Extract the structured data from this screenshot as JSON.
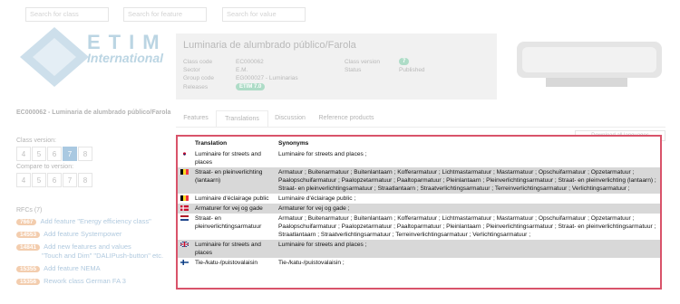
{
  "search": {
    "class_placeholder": "Search for class",
    "feature_placeholder": "Search for feature",
    "value_placeholder": "Search for value"
  },
  "logo": {
    "title": "ETIM",
    "subtitle": "International"
  },
  "infobox": {
    "title": "Luminaria de alumbrado público/Farola",
    "class_code_label": "Class code",
    "class_code": "EC000062",
    "sector_label": "Sector",
    "sector": "E.M.",
    "group_code_label": "Group code",
    "group_code": "EG000027 - Luminarias",
    "releases_label": "Releases",
    "release_badge": "ETIM 7.0",
    "class_version_label": "Class version",
    "class_version": "7",
    "status_label": "Status",
    "status": "Published"
  },
  "sidebar": {
    "class_heading": "EC000062 - Luminaria de alumbrado público/Farola",
    "class_version_label": "Class version:",
    "versions": [
      "4",
      "5",
      "6",
      "7",
      "8"
    ],
    "compare_label": "Compare to version:",
    "compare_versions": [
      "4",
      "5",
      "6",
      "7",
      "8"
    ],
    "rfcs_label": "RFCs (7)",
    "rfcs": [
      {
        "num": "7667",
        "text": "Add feature \"Energy efficiency class\""
      },
      {
        "num": "14553",
        "text": "Add feature Systempower"
      },
      {
        "num": "14841",
        "text": "Add new features and values"
      },
      {
        "num": "",
        "text": "\"Touch and Dim\" \"DALIPush-button\" etc."
      },
      {
        "num": "15355",
        "text": "Add feature NEMA"
      },
      {
        "num": "15356",
        "text": "Rework class German FA 3"
      }
    ]
  },
  "tabs": [
    "Features",
    "Translations",
    "Discussion",
    "Reference products"
  ],
  "pdf_button": "Download all languages",
  "table": {
    "headers": {
      "translation": "Translation",
      "synonyms": "Synonyms"
    },
    "rows": [
      {
        "flag": "ko",
        "flag_colors": [
          "#ffffff",
          "#c60c30"
        ],
        "translation": "Luminaire for streets and places",
        "synonyms": "Luminaire for streets and places ;",
        "shaded": false
      },
      {
        "flag": "be",
        "flag_colors": [
          "#000000",
          "#fdda24",
          "#ef3340"
        ],
        "translation": "Straat- en pleinverlichting (lantaarn)",
        "synonyms": "Armatuur ; Buitenarmatuur ; Buitenlantaarn ; Kofferarmatuur ; Lichtmastarmatuur ; Mastarmatuur ; Opschuifarmatuur ; Opzetarmatuur ; Paalopschuifarmatuur ; Paalopzetarmatuur ; Paaltoparmatuur ; Pleinlantaarn ; Pleinverlichtingsarmatuur ; Straat- en pleinverlichting (lantaarn) ; Straat- en pleinverlichtingsarmatuur ; Straatlantaarn ; Straatverlichtingsarmatuur ; Terreinverlichtingsarmatuur ; Verlichtingsarmatuur ;",
        "shaded": true
      },
      {
        "flag": "be",
        "flag_colors": [
          "#000000",
          "#fdda24",
          "#ef3340"
        ],
        "translation": "Luminaire d'éclairage public",
        "synonyms": "Luminaire d'éclairage public ;",
        "shaded": false
      },
      {
        "flag": "dk",
        "flag_colors": [
          "#c8102e",
          "#ffffff"
        ],
        "translation": "Armaturer for vej og gade",
        "synonyms": "Armaturer for vej og gade ;",
        "shaded": true
      },
      {
        "flag": "nl",
        "flag_colors": [
          "#ae1c28",
          "#ffffff",
          "#21468b"
        ],
        "translation": "Straat- en pleinverlichtingsarmatuur",
        "synonyms": "Armatuur ; Buitenarmatuur ; Buitenlantaarn ; Kofferarmatuur ; Lichtmastarmatuur ; Mastarmatuur ; Opschuifarmatuur ; Opzetarmatuur ; Paalopschuifarmatuur ; Paalopzetarmatuur ; Paaltoparmatuur ; Pleinlantaarn ; Pleinverlichtingsarmatuur ; Straat- en pleinverlichtingsarmatuur ; Straatlantaarn ; Straatverlichtingsarmatuur ; Terreinverlichtingsarmatuur ; Verlichtingsarmatuur ;",
        "shaded": false
      },
      {
        "flag": "gb",
        "flag_colors": [
          "#012169",
          "#ffffff",
          "#c8102e"
        ],
        "translation": "Luminaire for streets and places",
        "synonyms": "Luminaire for streets and places ;",
        "shaded": true
      },
      {
        "flag": "fi",
        "flag_colors": [
          "#ffffff",
          "#003580"
        ],
        "translation": "Tie-/katu-/puistovalaisin",
        "synonyms": "Tie-/katu-/puistovalaisin ;",
        "shaded": false
      }
    ]
  }
}
